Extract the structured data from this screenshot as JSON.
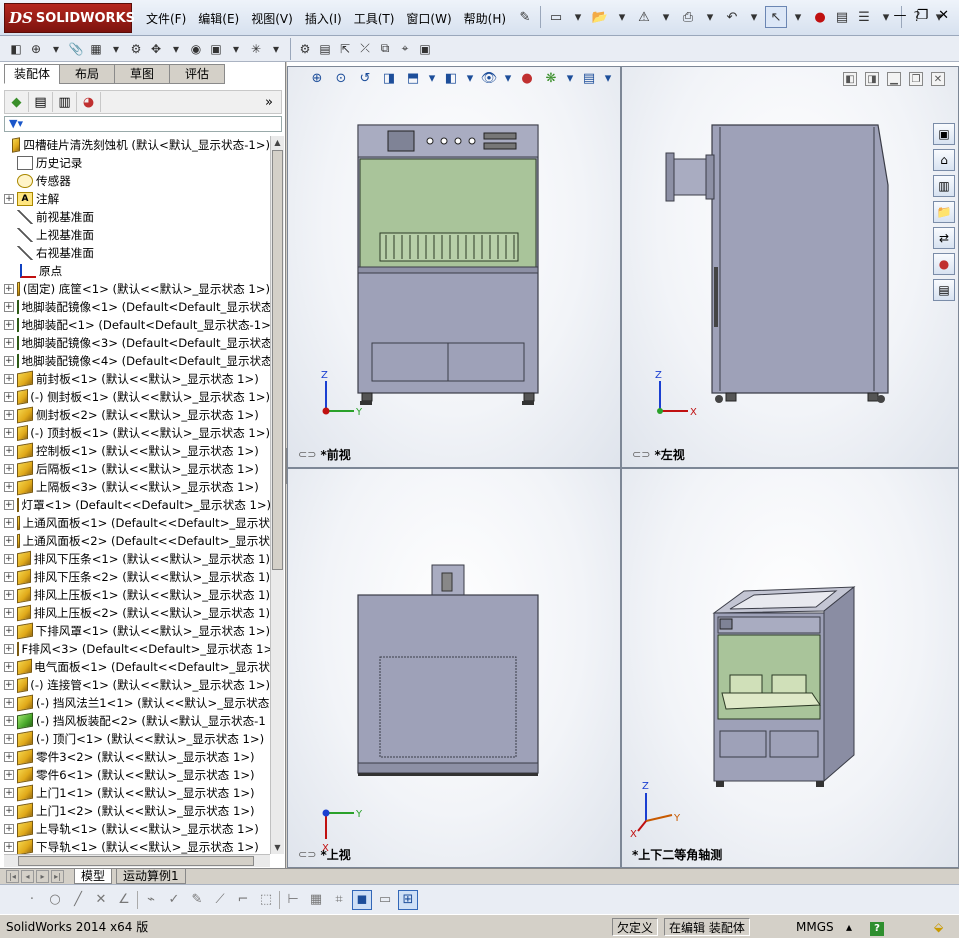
{
  "app": {
    "logo_ds": "DS",
    "logo_text": "SOLIDWORKS"
  },
  "menu": [
    "文件(F)",
    "编辑(E)",
    "视图(V)",
    "插入(I)",
    "工具(T)",
    "窗口(W)",
    "帮助(H)"
  ],
  "icons": {
    "pin": "pin-icon",
    "new": "new-document-icon",
    "open": "open-icon",
    "rebuild": "rebuild-icon",
    "print": "print-icon",
    "undo": "undo-icon",
    "select": "select-arrow-icon",
    "traffic": "traffic-light-icon",
    "options": "options-icon",
    "help": "help-icon"
  },
  "left_panel": {
    "tabs": [
      "装配体",
      "布局",
      "草图",
      "评估"
    ],
    "active_tab": 0,
    "more_glyph": "»",
    "filter_glyph": "▼▾"
  },
  "tree": {
    "root": "四槽硅片清洗刻蚀机 (默认<默认_显示状态-1>)",
    "fixed_items": [
      {
        "label": "历史记录",
        "icon": "history"
      },
      {
        "label": "传感器",
        "icon": "sensor"
      },
      {
        "label": "注解",
        "icon": "annotation",
        "expandable": true
      },
      {
        "label": "前视基准面",
        "icon": "plane"
      },
      {
        "label": "上视基准面",
        "icon": "plane"
      },
      {
        "label": "右视基准面",
        "icon": "plane"
      },
      {
        "label": "原点",
        "icon": "origin"
      }
    ],
    "components": [
      {
        "label": "(固定) 底筐<1> (默认<<默认>_显示状态 1>)",
        "green": false
      },
      {
        "label": "地脚装配镜像<1> (Default<Default_显示状态",
        "green": true
      },
      {
        "label": "地脚装配<1> (Default<Default_显示状态-1>",
        "green": true
      },
      {
        "label": "地脚装配镜像<3> (Default<Default_显示状态",
        "green": true
      },
      {
        "label": "地脚装配镜像<4> (Default<Default_显示状态",
        "green": true
      },
      {
        "label": "前封板<1> (默认<<默认>_显示状态 1>)",
        "green": false
      },
      {
        "label": "(-) 侧封板<1> (默认<<默认>_显示状态 1>)",
        "green": false
      },
      {
        "label": "侧封板<2> (默认<<默认>_显示状态 1>)",
        "green": false
      },
      {
        "label": "(-) 顶封板<1> (默认<<默认>_显示状态 1>)",
        "green": false
      },
      {
        "label": "控制板<1> (默认<<默认>_显示状态 1>)",
        "green": false
      },
      {
        "label": "后隔板<1> (默认<<默认>_显示状态 1>)",
        "green": false
      },
      {
        "label": "上隔板<3> (默认<<默认>_显示状态 1>)",
        "green": false
      },
      {
        "label": "灯罩<1> (Default<<Default>_显示状态 1>)",
        "green": false
      },
      {
        "label": "上通风面板<1> (Default<<Default>_显示状",
        "green": false
      },
      {
        "label": "上通风面板<2> (Default<<Default>_显示状",
        "green": false
      },
      {
        "label": "排风下压条<1> (默认<<默认>_显示状态 1)",
        "green": false
      },
      {
        "label": "排风下压条<2> (默认<<默认>_显示状态 1)",
        "green": false
      },
      {
        "label": "排风上压板<1> (默认<<默认>_显示状态 1)",
        "green": false
      },
      {
        "label": "排风上压板<2> (默认<<默认>_显示状态 1)",
        "green": false
      },
      {
        "label": "下排风罩<1> (默认<<默认>_显示状态 1>)",
        "green": false
      },
      {
        "label": "F排风<3> (Default<<Default>_显示状态 1>)",
        "green": false
      },
      {
        "label": "电气面板<1> (Default<<Default>_显示状",
        "green": false
      },
      {
        "label": "(-) 连接管<1> (默认<<默认>_显示状态 1>)",
        "green": false
      },
      {
        "label": "(-) 挡风法兰1<1> (默认<<默认>_显示状态",
        "green": false
      },
      {
        "label": "(-) 挡风板装配<2> (默认<默认_显示状态-1",
        "green": true
      },
      {
        "label": "(-) 顶门<1> (默认<<默认>_显示状态 1>)",
        "green": false
      },
      {
        "label": "零件3<2> (默认<<默认>_显示状态 1>)",
        "green": false
      },
      {
        "label": "零件6<1> (默认<<默认>_显示状态 1>)",
        "green": false
      },
      {
        "label": "上门1<1> (默认<<默认>_显示状态 1>)",
        "green": false
      },
      {
        "label": "上门1<2> (默认<<默认>_显示状态 1>)",
        "green": false
      },
      {
        "label": "上导轨<1> (默认<<默认>_显示状态 1>)",
        "green": false
      },
      {
        "label": "下导轨<1> (默认<<默认>_显示状态 1>)",
        "green": false
      }
    ]
  },
  "viewports": {
    "front": "*前视",
    "left": "*左视",
    "top": "*上视",
    "iso": "*上下二等角轴测"
  },
  "triad": {
    "x": "X",
    "y": "Y",
    "z": "Z"
  },
  "bottom_tabs": [
    "模型",
    "运动算例1"
  ],
  "status": {
    "version": "SolidWorks 2014 x64 版",
    "definition": "欠定义",
    "mode": "在编辑 装配体",
    "units": "MMGS"
  },
  "colors": {
    "cabinet": "#9ea1b8",
    "cabinet_dark": "#6e7186",
    "chamber": "#a9c49a",
    "titlebar_red": "#b5271f"
  }
}
